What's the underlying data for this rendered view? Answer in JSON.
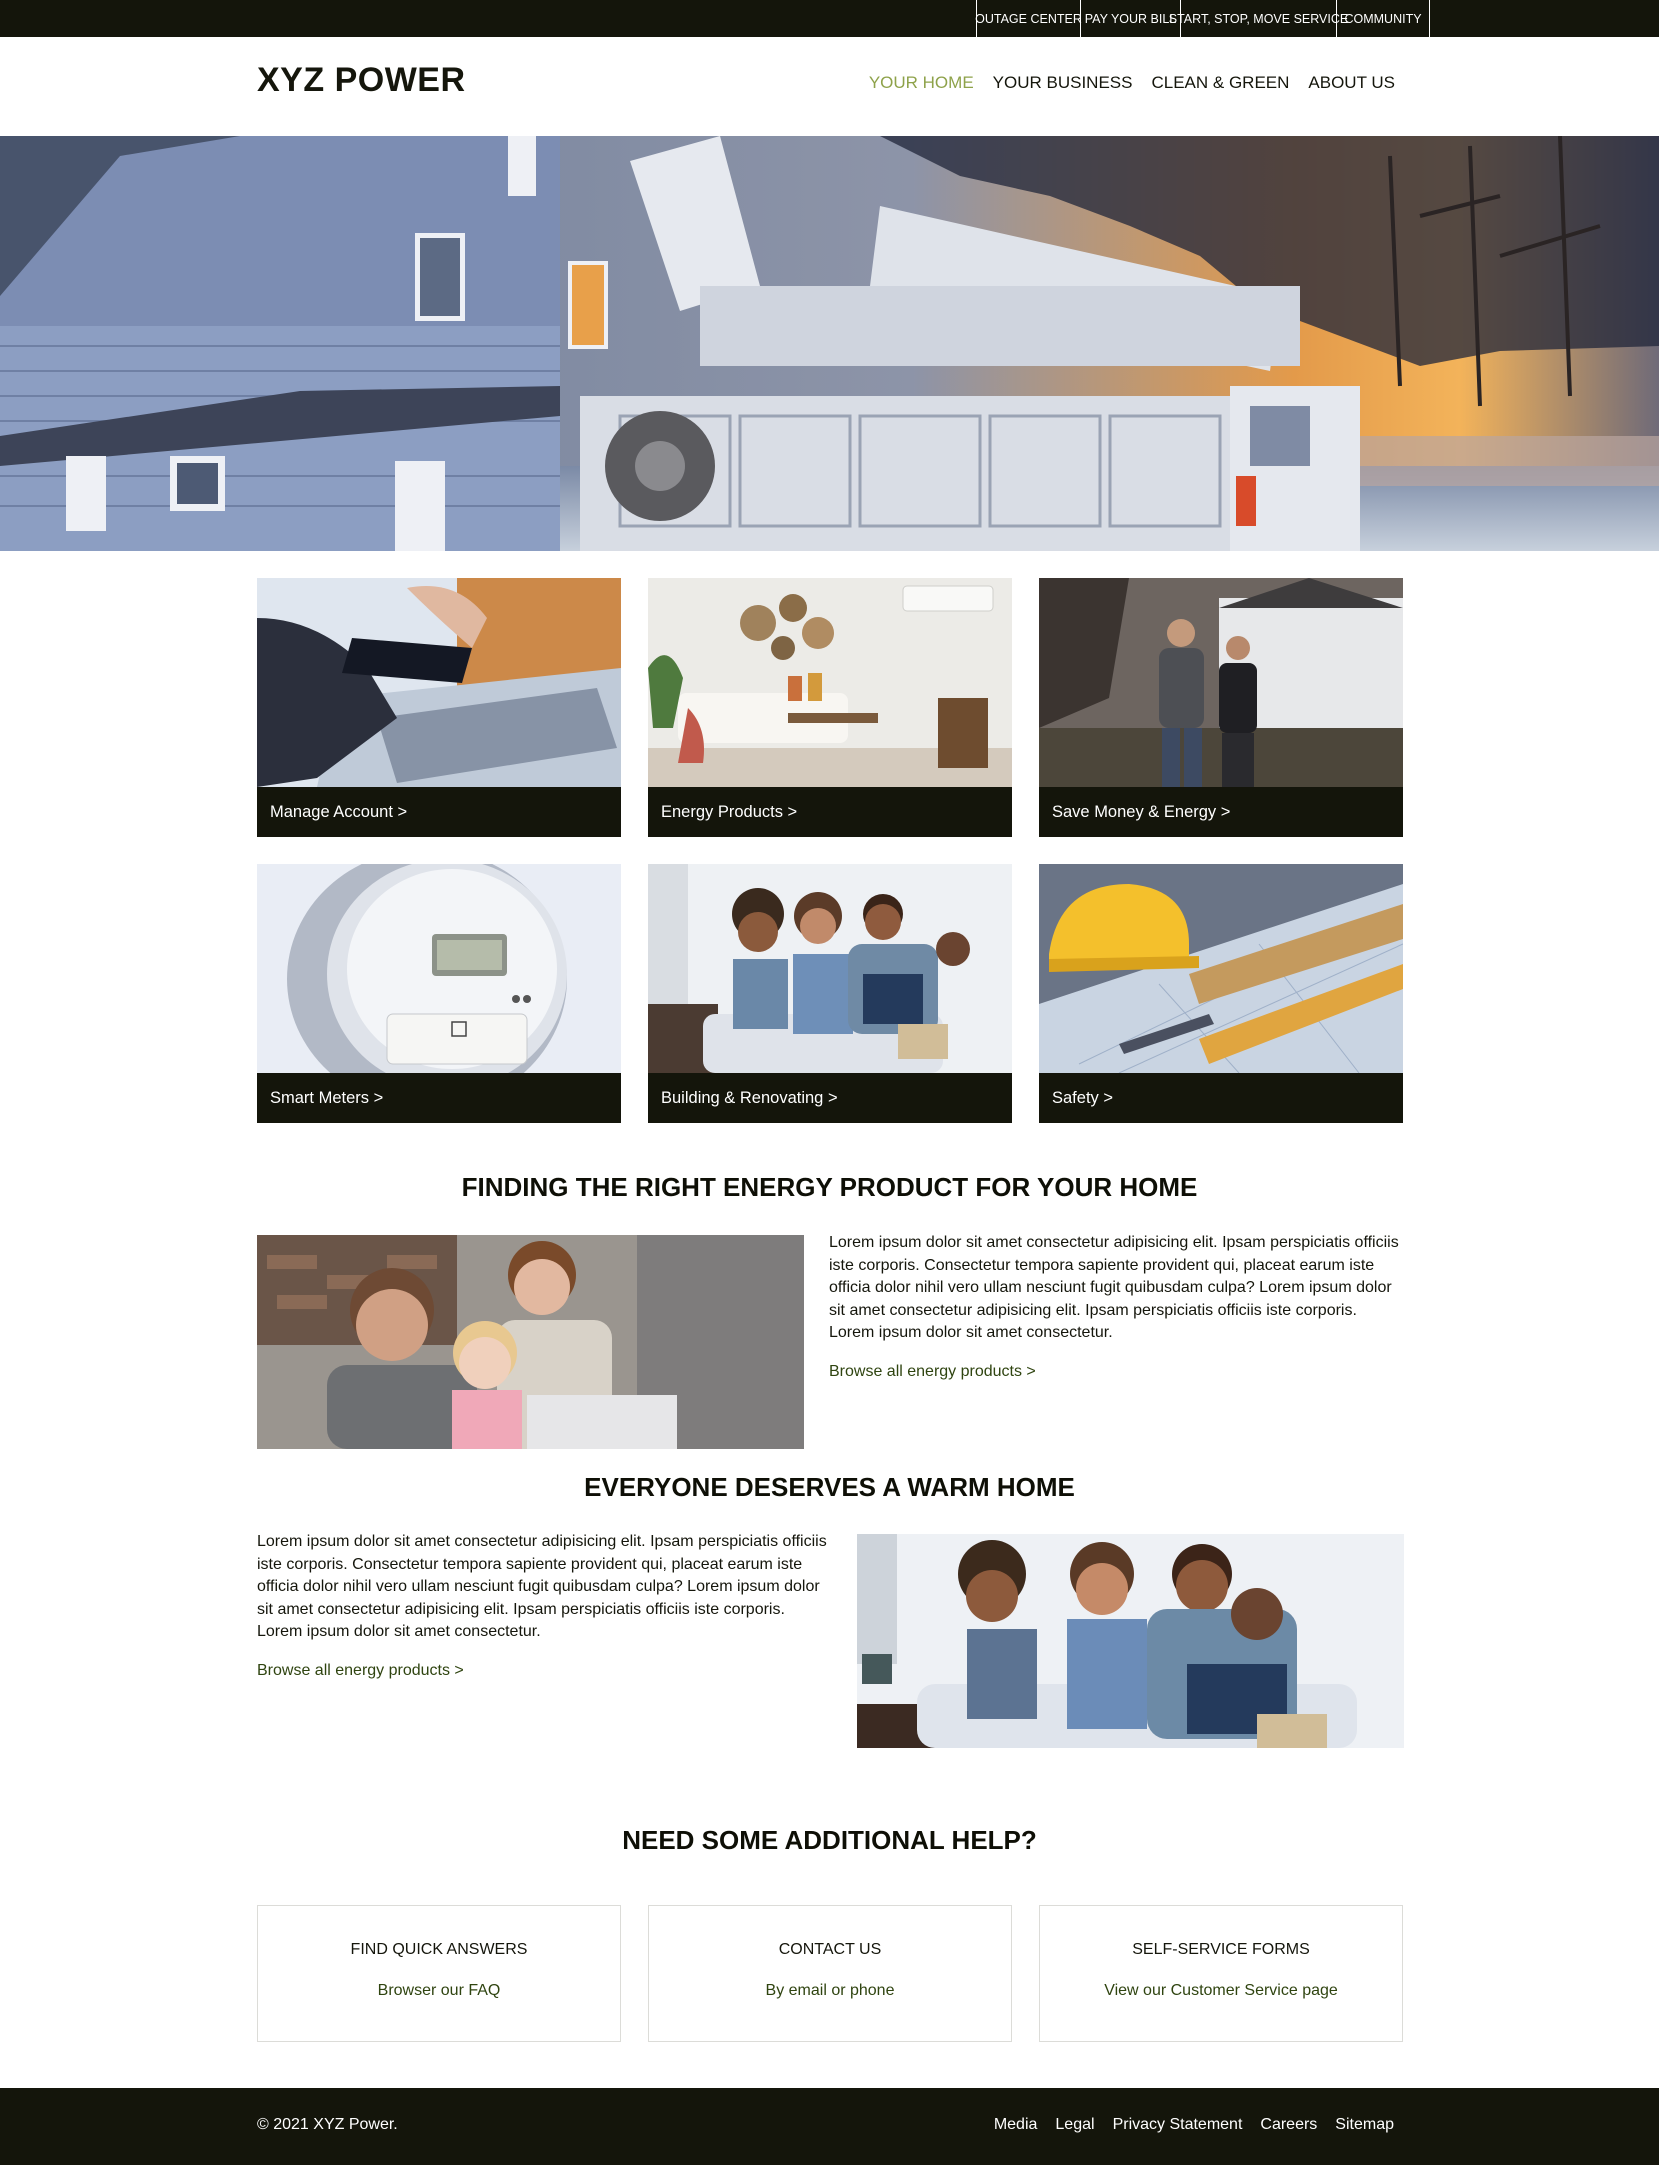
{
  "utility_nav": [
    "OUTAGE CENTER",
    "PAY YOUR BILL",
    "START, STOP, MOVE SERVICE",
    "COMMUNITY"
  ],
  "header": {
    "logo": "XYZ POWER",
    "nav": [
      "YOUR HOME",
      "YOUR BUSINESS",
      "CLEAN & GREEN",
      "ABOUT US"
    ],
    "active_nav": "YOUR HOME"
  },
  "tiles": [
    {
      "label": "Manage Account >"
    },
    {
      "label": "Energy Products >"
    },
    {
      "label": "Save Money & Energy >"
    },
    {
      "label": "Smart Meters >"
    },
    {
      "label": "Building & Renovating >"
    },
    {
      "label": "Safety >"
    }
  ],
  "section1": {
    "title": "FINDING THE RIGHT ENERGY PRODUCT FOR YOUR HOME",
    "text": "Lorem ipsum dolor sit amet consectetur adipisicing elit. Ipsam perspiciatis officiis iste corporis. Consectetur tempora sapiente provident qui, placeat earum iste officia dolor nihil vero ullam nesciunt fugit quibusdam culpa? Lorem ipsum dolor sit amet consectetur adipisicing elit. Ipsam perspiciatis officiis iste corporis. Lorem ipsum dolor sit amet consectetur.",
    "link": "Browse all energy products >"
  },
  "section2": {
    "title": "EVERYONE DESERVES A WARM HOME",
    "text": "Lorem ipsum dolor sit amet consectetur adipisicing elit. Ipsam perspiciatis officiis iste corporis. Consectetur tempora sapiente provident qui, placeat earum iste officia dolor nihil vero ullam nesciunt fugit quibusdam culpa? Lorem ipsum dolor sit amet consectetur adipisicing elit. Ipsam perspiciatis officiis iste corporis. Lorem ipsum dolor sit amet consectetur.",
    "link": "Browse all energy products >"
  },
  "help": {
    "title": "NEED SOME ADDITIONAL HELP?",
    "boxes": [
      {
        "title": "FIND QUICK ANSWERS",
        "link": "Browser our FAQ"
      },
      {
        "title": "CONTACT US",
        "link": "By email or phone"
      },
      {
        "title": "SELF-SERVICE FORMS",
        "link": "View our Customer Service page"
      }
    ]
  },
  "footer": {
    "copyright": "© 2021 XYZ Power.",
    "links": [
      "Media",
      "Legal",
      "Privacy Statement",
      "Careers",
      "Sitemap"
    ]
  },
  "colors": {
    "dark": "#14150b",
    "accent_active": "#8ea24a",
    "link_green": "#2f4410"
  }
}
